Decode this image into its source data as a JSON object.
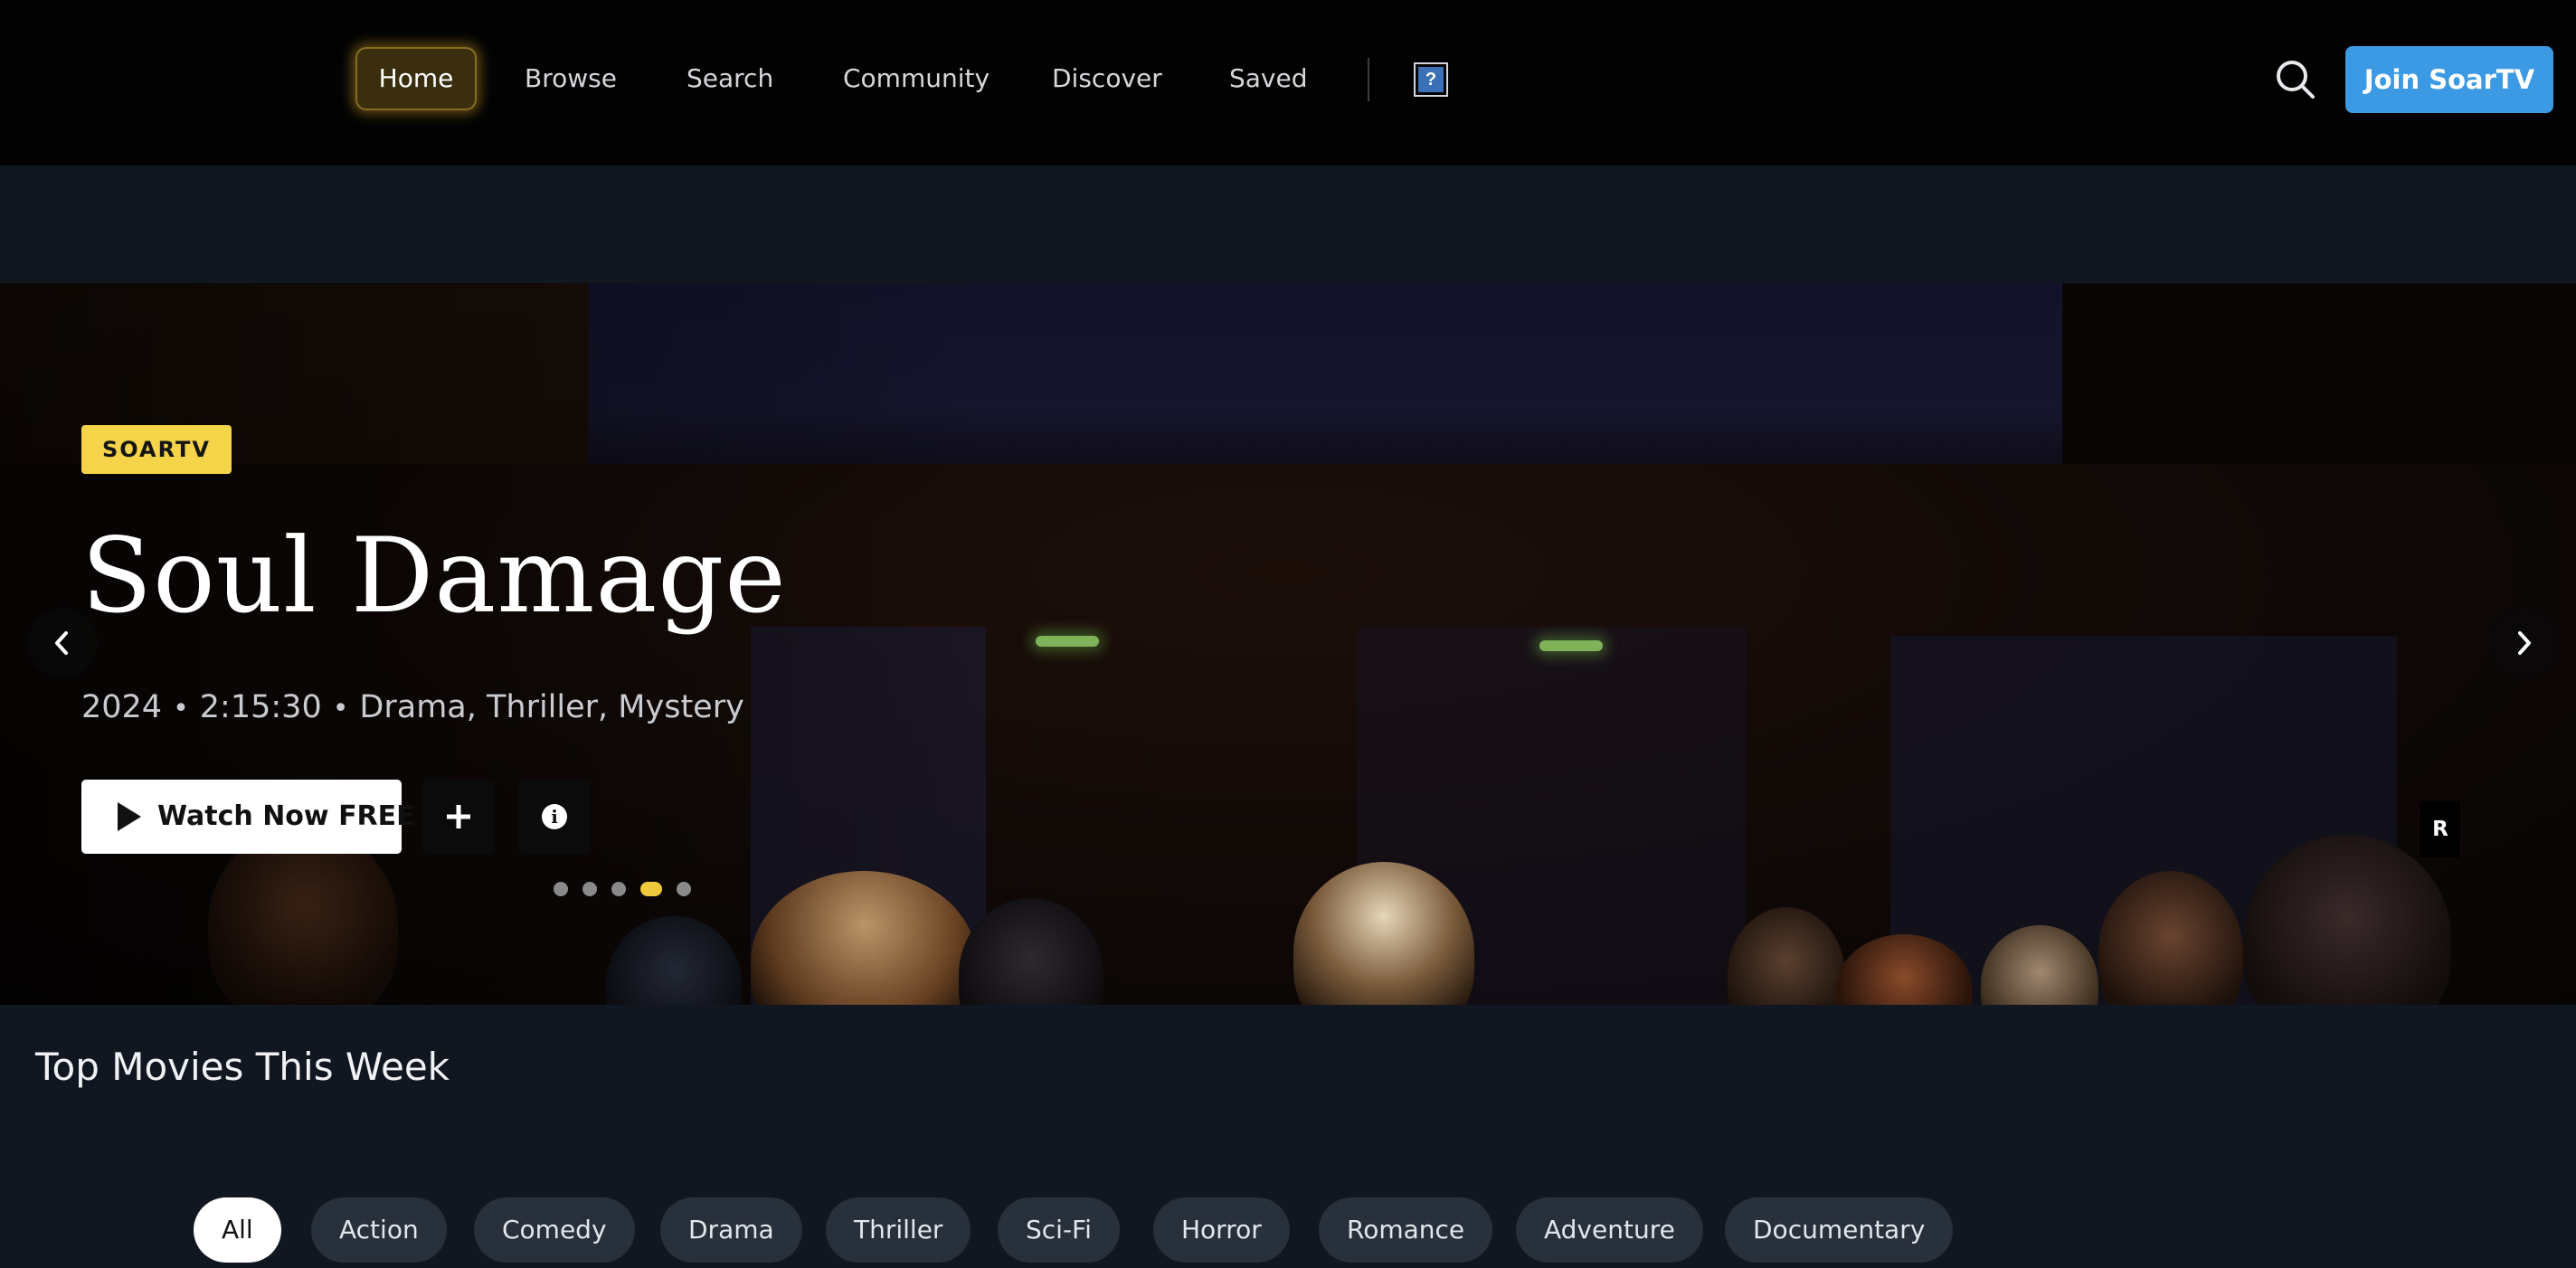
{
  "nav": {
    "items": [
      {
        "label": "Home",
        "active": true
      },
      {
        "label": "Browse"
      },
      {
        "label": "Search"
      },
      {
        "label": "Community"
      },
      {
        "label": "Discover"
      },
      {
        "label": "Saved"
      }
    ],
    "help_label": "?",
    "search_icon": "search-icon",
    "join_label": "Join SoarTV",
    "accent": "#3b9ae3"
  },
  "hero": {
    "badge": "SOARTV",
    "title": "Soul Damage",
    "year": "2024",
    "duration": "2:15:30",
    "genres": "Drama, Thriller, Mystery",
    "separator": "•",
    "watch_label": "Watch Now FREE",
    "add_icon": "plus-icon",
    "info_icon": "info-icon",
    "rating": "R",
    "slides": 5,
    "active_slide": 4,
    "badge_color": "#f5d44a"
  },
  "section": {
    "title": "Top Movies This Week",
    "filters": [
      "All",
      "Action",
      "Comedy",
      "Drama",
      "Thriller",
      "Sci-Fi",
      "Horror",
      "Romance",
      "Adventure",
      "Documentary"
    ],
    "active_filter": "All"
  }
}
